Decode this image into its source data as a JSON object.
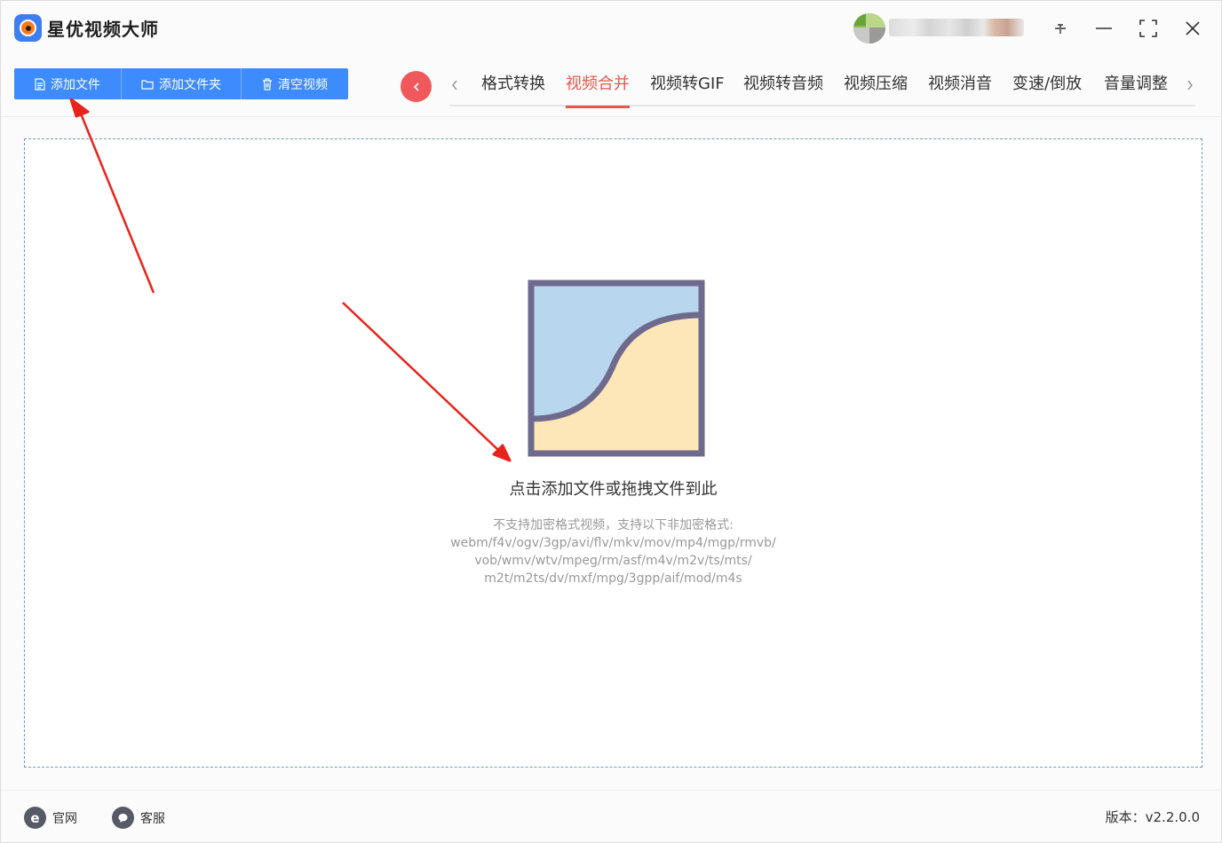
{
  "app": {
    "title": "星优视频大师"
  },
  "toolbar": {
    "add_file": "添加文件",
    "add_folder": "添加文件夹",
    "clear_videos": "清空视频"
  },
  "tabs": [
    {
      "label": "格式转换",
      "active": false
    },
    {
      "label": "视频合并",
      "active": true
    },
    {
      "label": "视频转GIF",
      "active": false
    },
    {
      "label": "视频转音频",
      "active": false
    },
    {
      "label": "视频压缩",
      "active": false
    },
    {
      "label": "视频消音",
      "active": false
    },
    {
      "label": "变速/倒放",
      "active": false
    },
    {
      "label": "音量调整",
      "active": false
    }
  ],
  "dropzone": {
    "title": "点击添加文件或拖拽文件到此",
    "hint_lines": [
      "不支持加密格式视频，支持以下非加密格式:",
      "webm/f4v/ogv/3gp/avi/flv/mkv/mov/mp4/mgp/rmvb/",
      "vob/wmv/wtv/mpeg/rm/asf/m4v/m2v/ts/mts/",
      "m2t/m2ts/dv/mxf/mpg/3gpp/aif/mod/m4s"
    ]
  },
  "footer": {
    "website": "官网",
    "service": "客服",
    "version": "版本：v2.2.0.0"
  },
  "icons": {
    "window_controls": [
      "pin-icon",
      "minimize-icon",
      "maximize-icon",
      "close-icon"
    ],
    "footer": [
      "ie-icon",
      "chat-icon"
    ]
  },
  "colors": {
    "primary": "#3d8bfd",
    "accent_red": "#e4584f",
    "back_button": "#f0585b",
    "dropzone_border": "#6f9ac6",
    "annotation_arrow": "#e8231c"
  }
}
